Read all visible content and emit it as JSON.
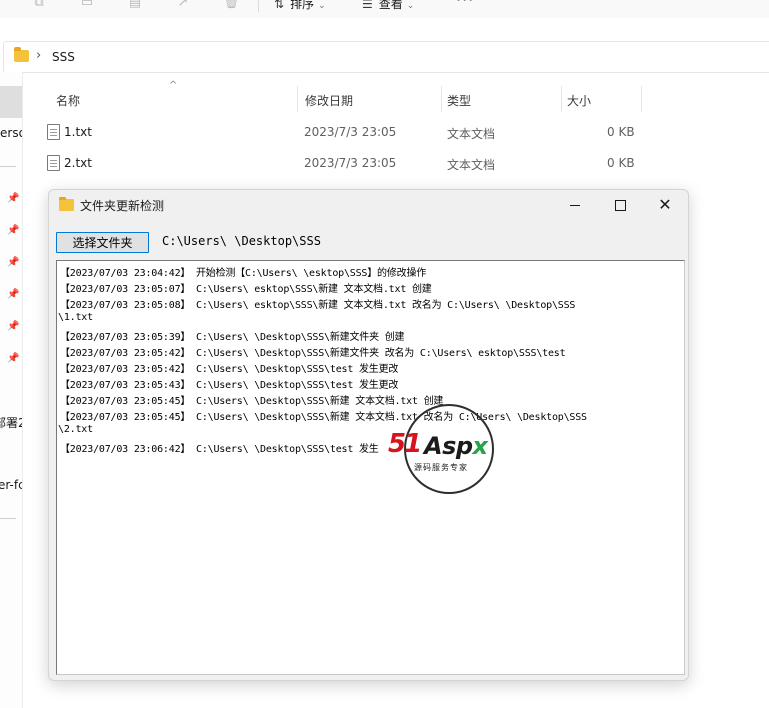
{
  "toolbar": {
    "sort_label": "排序",
    "view_label": "查看",
    "more_label": "···"
  },
  "address_bar": {
    "path": "SSS"
  },
  "nav_pane": {
    "items": [
      {
        "label": "erso"
      },
      {
        "label": "部署2"
      },
      {
        "label": "er-fc"
      }
    ]
  },
  "file_list": {
    "columns": [
      "名称",
      "修改日期",
      "类型",
      "大小"
    ],
    "rows": [
      {
        "name": "1.txt",
        "modified": "2023/7/3 23:05",
        "type": "文本文档",
        "size": "0 KB"
      },
      {
        "name": "2.txt",
        "modified": "2023/7/3 23:05",
        "type": "文本文档",
        "size": "0 KB"
      }
    ]
  },
  "dialog": {
    "title": "文件夹更新检测",
    "choose_button": "选择文件夹",
    "selected_path": "C:\\Users\\        \\Desktop\\SSS",
    "log_lines": [
      "【2023/07/03 23:04:42】 开始检测【C:\\Users\\        \\esktop\\SSS】的修改操作",
      "【2023/07/03 23:05:07】 C:\\Users\\        esktop\\SSS\\新建 文本文档.txt 创建",
      "【2023/07/03 23:05:08】 C:\\Users\\        esktop\\SSS\\新建 文本文档.txt 改名为 C:\\Users\\        \\Desktop\\SSS",
      "\\1.txt",
      "【2023/07/03 23:05:39】 C:\\Users\\        \\Desktop\\SSS\\新建文件夹 创建",
      "【2023/07/03 23:05:42】 C:\\Users\\        \\Desktop\\SSS\\新建文件夹 改名为 C:\\Users\\        esktop\\SSS\\test",
      "【2023/07/03 23:05:42】 C:\\Users\\        \\Desktop\\SSS\\test 发生更改",
      "【2023/07/03 23:05:43】 C:\\Users\\        \\Desktop\\SSS\\test 发生更改",
      "【2023/07/03 23:05:45】 C:\\Users\\        \\Desktop\\SSS\\新建 文本文档.txt 创建",
      "【2023/07/03 23:05:45】 C:\\Users\\        \\Desktop\\SSS\\新建 文本文档.txt 改名为 C:\\Users\\        \\Desktop\\SSS",
      "\\2.txt",
      "【2023/07/03 23:06:42】 C:\\Users\\        \\Desktop\\SSS\\test 发生"
    ]
  },
  "watermark": {
    "brand_51": "51",
    "brand_asp": "Asp",
    "brand_x": "x",
    "tagline": "源码服务专家"
  }
}
